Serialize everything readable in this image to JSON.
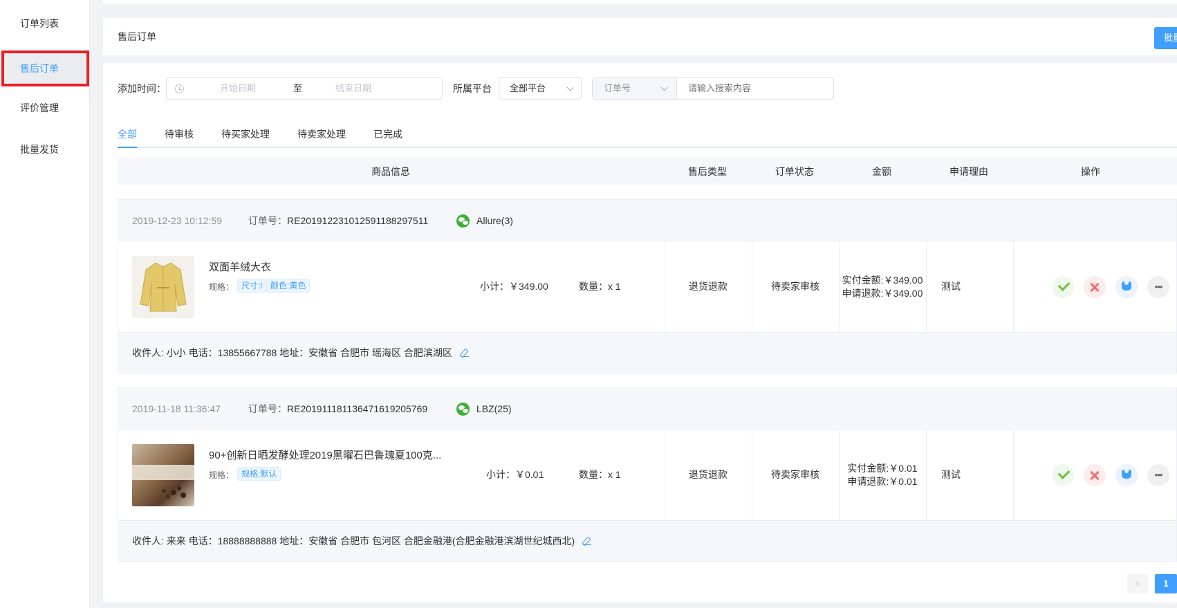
{
  "sidebar": {
    "items": [
      {
        "label": "订单列表"
      },
      {
        "label": "售后订单",
        "active": true
      },
      {
        "label": "评价管理"
      },
      {
        "label": "批量发货"
      }
    ]
  },
  "header": {
    "title": "售后订单",
    "button_label": "批量"
  },
  "filters": {
    "date_label": "添加时间：",
    "start_placeholder": "开始日期",
    "range_separator": "至",
    "end_placeholder": "结束日期",
    "platform_label": "所属平台",
    "platform_value": "全部平台",
    "search_type_value": "订单号",
    "search_placeholder": "请输入搜索内容"
  },
  "tabs": [
    {
      "label": "全部",
      "active": true
    },
    {
      "label": "待审核"
    },
    {
      "label": "待买家处理"
    },
    {
      "label": "待卖家处理"
    },
    {
      "label": "已完成"
    }
  ],
  "table": {
    "headers": [
      "商品信息",
      "售后类型",
      "订单状态",
      "金额",
      "申请理由",
      "操作"
    ]
  },
  "orders": [
    {
      "date": "2019-12-23 10:12:59",
      "order_no_label": "订单号：",
      "order_no": "RE20191223101259118829751​1",
      "user": "Allure(3)",
      "product_name": "双面羊绒大衣",
      "spec_label": "规格：",
      "specs": [
        "尺寸:l",
        "颜色:黄色"
      ],
      "subtotal": "小计：￥349.00",
      "quantity": "数量：x 1",
      "aftersale_type": "退货退款",
      "status": "待卖家审核",
      "paid": "实付金额:￥349.00",
      "refund": "申请退款:￥349.00",
      "reason": "测试",
      "address": "收件人: 小小 电话：13855667788 地址：安徽省 合肥市 瑶海区 合肥滨湖区"
    },
    {
      "date": "2019-11-18 11:36:47",
      "order_no_label": "订单号：",
      "order_no": "RE20191118113647161920576​9",
      "user": "LBZ(25)",
      "product_name": "90+创新日晒发酵处理2019黑曜石巴鲁瑰夏100克...",
      "spec_label": "规格：",
      "specs": [
        "规格:默认"
      ],
      "subtotal": "小计：￥0.01",
      "quantity": "数量：x 1",
      "aftersale_type": "退货退款",
      "status": "待卖家审核",
      "paid": "实付金额:￥0.01",
      "refund": "申请退款:￥0.01",
      "reason": "测试",
      "address": "收件人: 来来 电话：18888888888 地址：安徽省 合肥市 包河区 合肥金融港(合肥金融港滨湖世纪城西北)"
    }
  ],
  "pagination": {
    "prev_label": "‹",
    "current_page": "1"
  },
  "icons": {
    "clock": "clock-icon",
    "wechat": "wechat-icon",
    "approve": "check-icon",
    "reject": "close-icon",
    "tool": "wrench-icon",
    "more": "more-icon",
    "edit": "edit-icon"
  },
  "colors": {
    "accent": "#409eff",
    "success": "#67c23a",
    "danger": "#f56c6c",
    "highlight": "#ee1c25"
  }
}
